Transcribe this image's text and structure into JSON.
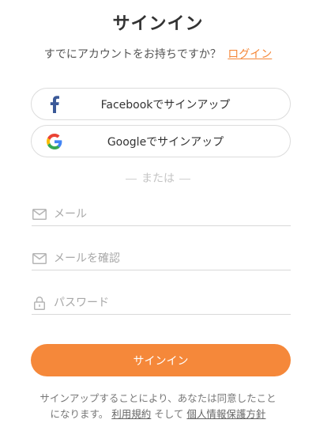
{
  "title": "サインイン",
  "have_account": {
    "text": "すでにアカウントをお持ちですか？",
    "login_link": "ログイン"
  },
  "social": {
    "facebook_label": "Facebookでサインアップ",
    "google_label": "Googleでサインアップ"
  },
  "or_divider": "または",
  "fields": {
    "email_placeholder": "メール",
    "email_confirm_placeholder": "メールを確認",
    "password_placeholder": "パスワード"
  },
  "signin_button": "サインイン",
  "terms": {
    "line1": "サインアップすることにより、あなたは同意したこと",
    "line2_prefix": "になります。",
    "terms_link": "利用規約",
    "and": "そして",
    "privacy_link": "個人情報保護方針"
  },
  "colors": {
    "accent": "#f5883a",
    "facebook": "#3b5998"
  },
  "icons": {
    "facebook": "facebook-icon",
    "google": "google-icon",
    "email": "envelope-icon",
    "password": "lock-icon"
  }
}
